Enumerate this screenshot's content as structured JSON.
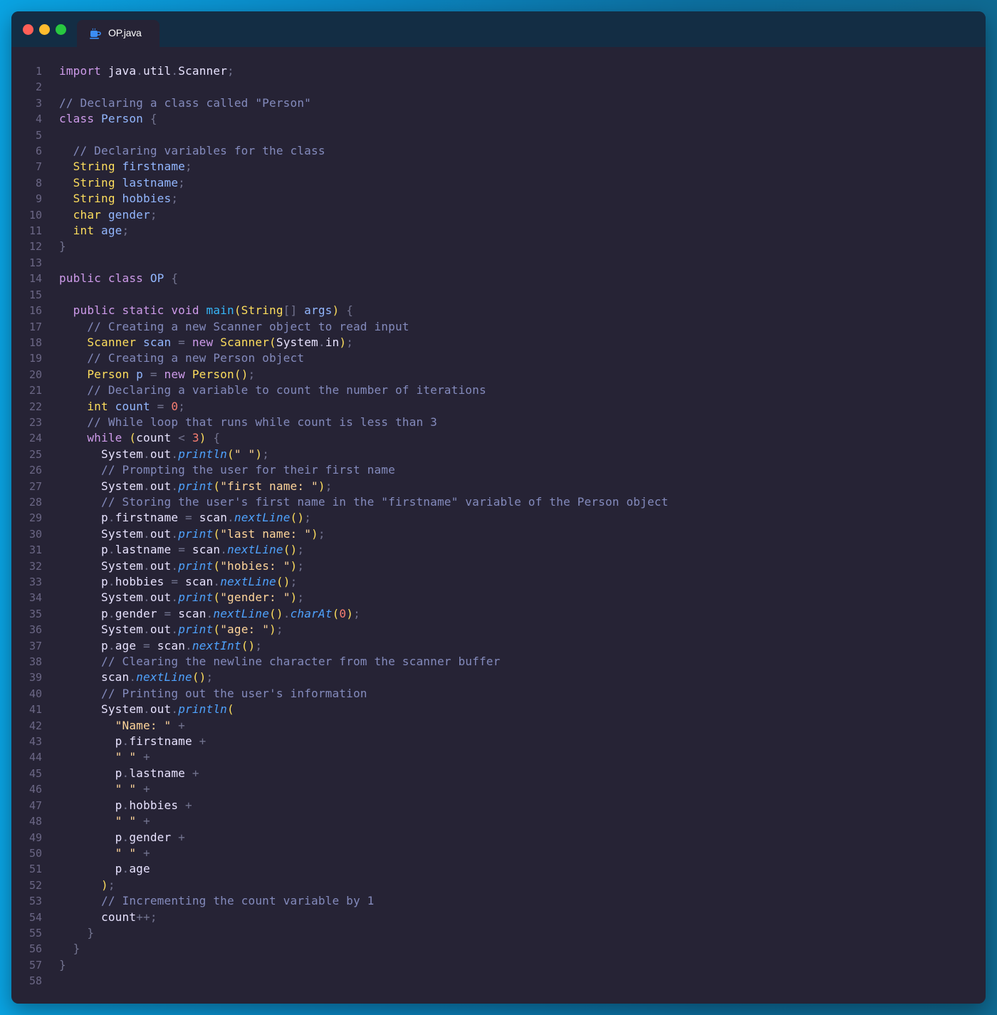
{
  "window": {
    "tab": {
      "label": "OP.java",
      "icon": "java-coffee-icon"
    },
    "colors": {
      "background_left": "#0aa3e2",
      "background_right": "#0f6a92",
      "titlebar": "#132d44",
      "editor": "#262335"
    }
  },
  "code_lines": [
    [
      [
        "kw",
        "import"
      ],
      [
        "nm",
        " java"
      ],
      [
        "pu",
        "."
      ],
      [
        "nm",
        "util"
      ],
      [
        "pu",
        "."
      ],
      [
        "nm",
        "Scanner"
      ],
      [
        "pu",
        ";"
      ]
    ],
    [],
    [
      [
        "cm",
        "// Declaring a class called \"Person\""
      ]
    ],
    [
      [
        "kw",
        "class"
      ],
      [
        "cl",
        " Person"
      ],
      [
        "pu",
        " {"
      ]
    ],
    [],
    [
      [
        "cm",
        "  // Declaring variables for the class"
      ]
    ],
    [
      [
        "ty",
        "  String"
      ],
      [
        "cl",
        " firstname"
      ],
      [
        "pu",
        ";"
      ]
    ],
    [
      [
        "ty",
        "  String"
      ],
      [
        "cl",
        " lastname"
      ],
      [
        "pu",
        ";"
      ]
    ],
    [
      [
        "ty",
        "  String"
      ],
      [
        "cl",
        " hobbies"
      ],
      [
        "pu",
        ";"
      ]
    ],
    [
      [
        "ty",
        "  char"
      ],
      [
        "cl",
        " gender"
      ],
      [
        "pu",
        ";"
      ]
    ],
    [
      [
        "ty",
        "  int"
      ],
      [
        "cl",
        " age"
      ],
      [
        "pu",
        ";"
      ]
    ],
    [
      [
        "pu",
        "}"
      ]
    ],
    [],
    [
      [
        "kw",
        "public class"
      ],
      [
        "cl",
        " OP"
      ],
      [
        "pu",
        " {"
      ]
    ],
    [],
    [
      [
        "kw",
        "  public static void"
      ],
      [
        "fn",
        " main"
      ],
      [
        "br",
        "("
      ],
      [
        "ty",
        "String"
      ],
      [
        "pu",
        "[]"
      ],
      [
        "cl",
        " args"
      ],
      [
        "br",
        ")"
      ],
      [
        "pu",
        " {"
      ]
    ],
    [
      [
        "cm",
        "    // Creating a new Scanner object to read input"
      ]
    ],
    [
      [
        "ty",
        "    Scanner"
      ],
      [
        "cl",
        " scan"
      ],
      [
        "pu",
        " ="
      ],
      [
        "kw",
        " new"
      ],
      [
        "ty",
        " Scanner"
      ],
      [
        "br",
        "("
      ],
      [
        "nm",
        "System"
      ],
      [
        "pu",
        "."
      ],
      [
        "nm",
        "in"
      ],
      [
        "br",
        ")"
      ],
      [
        "pu",
        ";"
      ]
    ],
    [
      [
        "cm",
        "    // Creating a new Person object"
      ]
    ],
    [
      [
        "ty",
        "    Person"
      ],
      [
        "cl",
        " p"
      ],
      [
        "pu",
        " ="
      ],
      [
        "kw",
        " new"
      ],
      [
        "ty",
        " Person"
      ],
      [
        "br",
        "()"
      ],
      [
        "pu",
        ";"
      ]
    ],
    [
      [
        "cm",
        "    // Declaring a variable to count the number of iterations"
      ]
    ],
    [
      [
        "ty",
        "    int"
      ],
      [
        "cl",
        " count"
      ],
      [
        "pu",
        " ="
      ],
      [
        "nu",
        " 0"
      ],
      [
        "pu",
        ";"
      ]
    ],
    [
      [
        "cm",
        "    // While loop that runs while count is less than 3"
      ]
    ],
    [
      [
        "kw",
        "    while"
      ],
      [
        "br",
        " ("
      ],
      [
        "nm",
        "count"
      ],
      [
        "pu",
        " <"
      ],
      [
        "nu",
        " 3"
      ],
      [
        "br",
        ")"
      ],
      [
        "pu",
        " {"
      ]
    ],
    [
      [
        "nm",
        "      System"
      ],
      [
        "pu",
        "."
      ],
      [
        "nm",
        "out"
      ],
      [
        "pu",
        "."
      ],
      [
        "mt",
        "println"
      ],
      [
        "br",
        "("
      ],
      [
        "st",
        "\" \""
      ],
      [
        "br",
        ")"
      ],
      [
        "pu",
        ";"
      ]
    ],
    [
      [
        "cm",
        "      // Prompting the user for their first name"
      ]
    ],
    [
      [
        "nm",
        "      System"
      ],
      [
        "pu",
        "."
      ],
      [
        "nm",
        "out"
      ],
      [
        "pu",
        "."
      ],
      [
        "mt",
        "print"
      ],
      [
        "br",
        "("
      ],
      [
        "st",
        "\"first name: \""
      ],
      [
        "br",
        ")"
      ],
      [
        "pu",
        ";"
      ]
    ],
    [
      [
        "cm",
        "      // Storing the user's first name in the \"firstname\" variable of the Person object"
      ]
    ],
    [
      [
        "nm",
        "      p"
      ],
      [
        "pu",
        "."
      ],
      [
        "nm",
        "firstname"
      ],
      [
        "pu",
        " ="
      ],
      [
        "nm",
        " scan"
      ],
      [
        "pu",
        "."
      ],
      [
        "mt",
        "nextLine"
      ],
      [
        "br",
        "()"
      ],
      [
        "pu",
        ";"
      ]
    ],
    [
      [
        "nm",
        "      System"
      ],
      [
        "pu",
        "."
      ],
      [
        "nm",
        "out"
      ],
      [
        "pu",
        "."
      ],
      [
        "mt",
        "print"
      ],
      [
        "br",
        "("
      ],
      [
        "st",
        "\"last name: \""
      ],
      [
        "br",
        ")"
      ],
      [
        "pu",
        ";"
      ]
    ],
    [
      [
        "nm",
        "      p"
      ],
      [
        "pu",
        "."
      ],
      [
        "nm",
        "lastname"
      ],
      [
        "pu",
        " ="
      ],
      [
        "nm",
        " scan"
      ],
      [
        "pu",
        "."
      ],
      [
        "mt",
        "nextLine"
      ],
      [
        "br",
        "()"
      ],
      [
        "pu",
        ";"
      ]
    ],
    [
      [
        "nm",
        "      System"
      ],
      [
        "pu",
        "."
      ],
      [
        "nm",
        "out"
      ],
      [
        "pu",
        "."
      ],
      [
        "mt",
        "print"
      ],
      [
        "br",
        "("
      ],
      [
        "st",
        "\"hobies: \""
      ],
      [
        "br",
        ")"
      ],
      [
        "pu",
        ";"
      ]
    ],
    [
      [
        "nm",
        "      p"
      ],
      [
        "pu",
        "."
      ],
      [
        "nm",
        "hobbies"
      ],
      [
        "pu",
        " ="
      ],
      [
        "nm",
        " scan"
      ],
      [
        "pu",
        "."
      ],
      [
        "mt",
        "nextLine"
      ],
      [
        "br",
        "()"
      ],
      [
        "pu",
        ";"
      ]
    ],
    [
      [
        "nm",
        "      System"
      ],
      [
        "pu",
        "."
      ],
      [
        "nm",
        "out"
      ],
      [
        "pu",
        "."
      ],
      [
        "mt",
        "print"
      ],
      [
        "br",
        "("
      ],
      [
        "st",
        "\"gender: \""
      ],
      [
        "br",
        ")"
      ],
      [
        "pu",
        ";"
      ]
    ],
    [
      [
        "nm",
        "      p"
      ],
      [
        "pu",
        "."
      ],
      [
        "nm",
        "gender"
      ],
      [
        "pu",
        " ="
      ],
      [
        "nm",
        " scan"
      ],
      [
        "pu",
        "."
      ],
      [
        "mt",
        "nextLine"
      ],
      [
        "br",
        "()"
      ],
      [
        "pu",
        "."
      ],
      [
        "mt",
        "charAt"
      ],
      [
        "br",
        "("
      ],
      [
        "nu",
        "0"
      ],
      [
        "br",
        ")"
      ],
      [
        "pu",
        ";"
      ]
    ],
    [
      [
        "nm",
        "      System"
      ],
      [
        "pu",
        "."
      ],
      [
        "nm",
        "out"
      ],
      [
        "pu",
        "."
      ],
      [
        "mt",
        "print"
      ],
      [
        "br",
        "("
      ],
      [
        "st",
        "\"age: \""
      ],
      [
        "br",
        ")"
      ],
      [
        "pu",
        ";"
      ]
    ],
    [
      [
        "nm",
        "      p"
      ],
      [
        "pu",
        "."
      ],
      [
        "nm",
        "age"
      ],
      [
        "pu",
        " ="
      ],
      [
        "nm",
        " scan"
      ],
      [
        "pu",
        "."
      ],
      [
        "mt",
        "nextInt"
      ],
      [
        "br",
        "()"
      ],
      [
        "pu",
        ";"
      ]
    ],
    [
      [
        "cm",
        "      // Clearing the newline character from the scanner buffer"
      ]
    ],
    [
      [
        "nm",
        "      scan"
      ],
      [
        "pu",
        "."
      ],
      [
        "mt",
        "nextLine"
      ],
      [
        "br",
        "()"
      ],
      [
        "pu",
        ";"
      ]
    ],
    [
      [
        "cm",
        "      // Printing out the user's information"
      ]
    ],
    [
      [
        "nm",
        "      System"
      ],
      [
        "pu",
        "."
      ],
      [
        "nm",
        "out"
      ],
      [
        "pu",
        "."
      ],
      [
        "mt",
        "println"
      ],
      [
        "br",
        "("
      ]
    ],
    [
      [
        "st",
        "        \"Name: \""
      ],
      [
        "pu",
        " +"
      ]
    ],
    [
      [
        "nm",
        "        p"
      ],
      [
        "pu",
        "."
      ],
      [
        "nm",
        "firstname"
      ],
      [
        "pu",
        " +"
      ]
    ],
    [
      [
        "st",
        "        \" \""
      ],
      [
        "pu",
        " +"
      ]
    ],
    [
      [
        "nm",
        "        p"
      ],
      [
        "pu",
        "."
      ],
      [
        "nm",
        "lastname"
      ],
      [
        "pu",
        " +"
      ]
    ],
    [
      [
        "st",
        "        \" \""
      ],
      [
        "pu",
        " +"
      ]
    ],
    [
      [
        "nm",
        "        p"
      ],
      [
        "pu",
        "."
      ],
      [
        "nm",
        "hobbies"
      ],
      [
        "pu",
        " +"
      ]
    ],
    [
      [
        "st",
        "        \" \""
      ],
      [
        "pu",
        " +"
      ]
    ],
    [
      [
        "nm",
        "        p"
      ],
      [
        "pu",
        "."
      ],
      [
        "nm",
        "gender"
      ],
      [
        "pu",
        " +"
      ]
    ],
    [
      [
        "st",
        "        \" \""
      ],
      [
        "pu",
        " +"
      ]
    ],
    [
      [
        "nm",
        "        p"
      ],
      [
        "pu",
        "."
      ],
      [
        "nm",
        "age"
      ]
    ],
    [
      [
        "br",
        "      )"
      ],
      [
        "pu",
        ";"
      ]
    ],
    [
      [
        "cm",
        "      // Incrementing the count variable by 1"
      ]
    ],
    [
      [
        "nm",
        "      count"
      ],
      [
        "pu",
        "++;"
      ]
    ],
    [
      [
        "pu",
        "    }"
      ]
    ],
    [
      [
        "pu",
        "  }"
      ]
    ],
    [
      [
        "pu",
        "}"
      ]
    ],
    []
  ]
}
